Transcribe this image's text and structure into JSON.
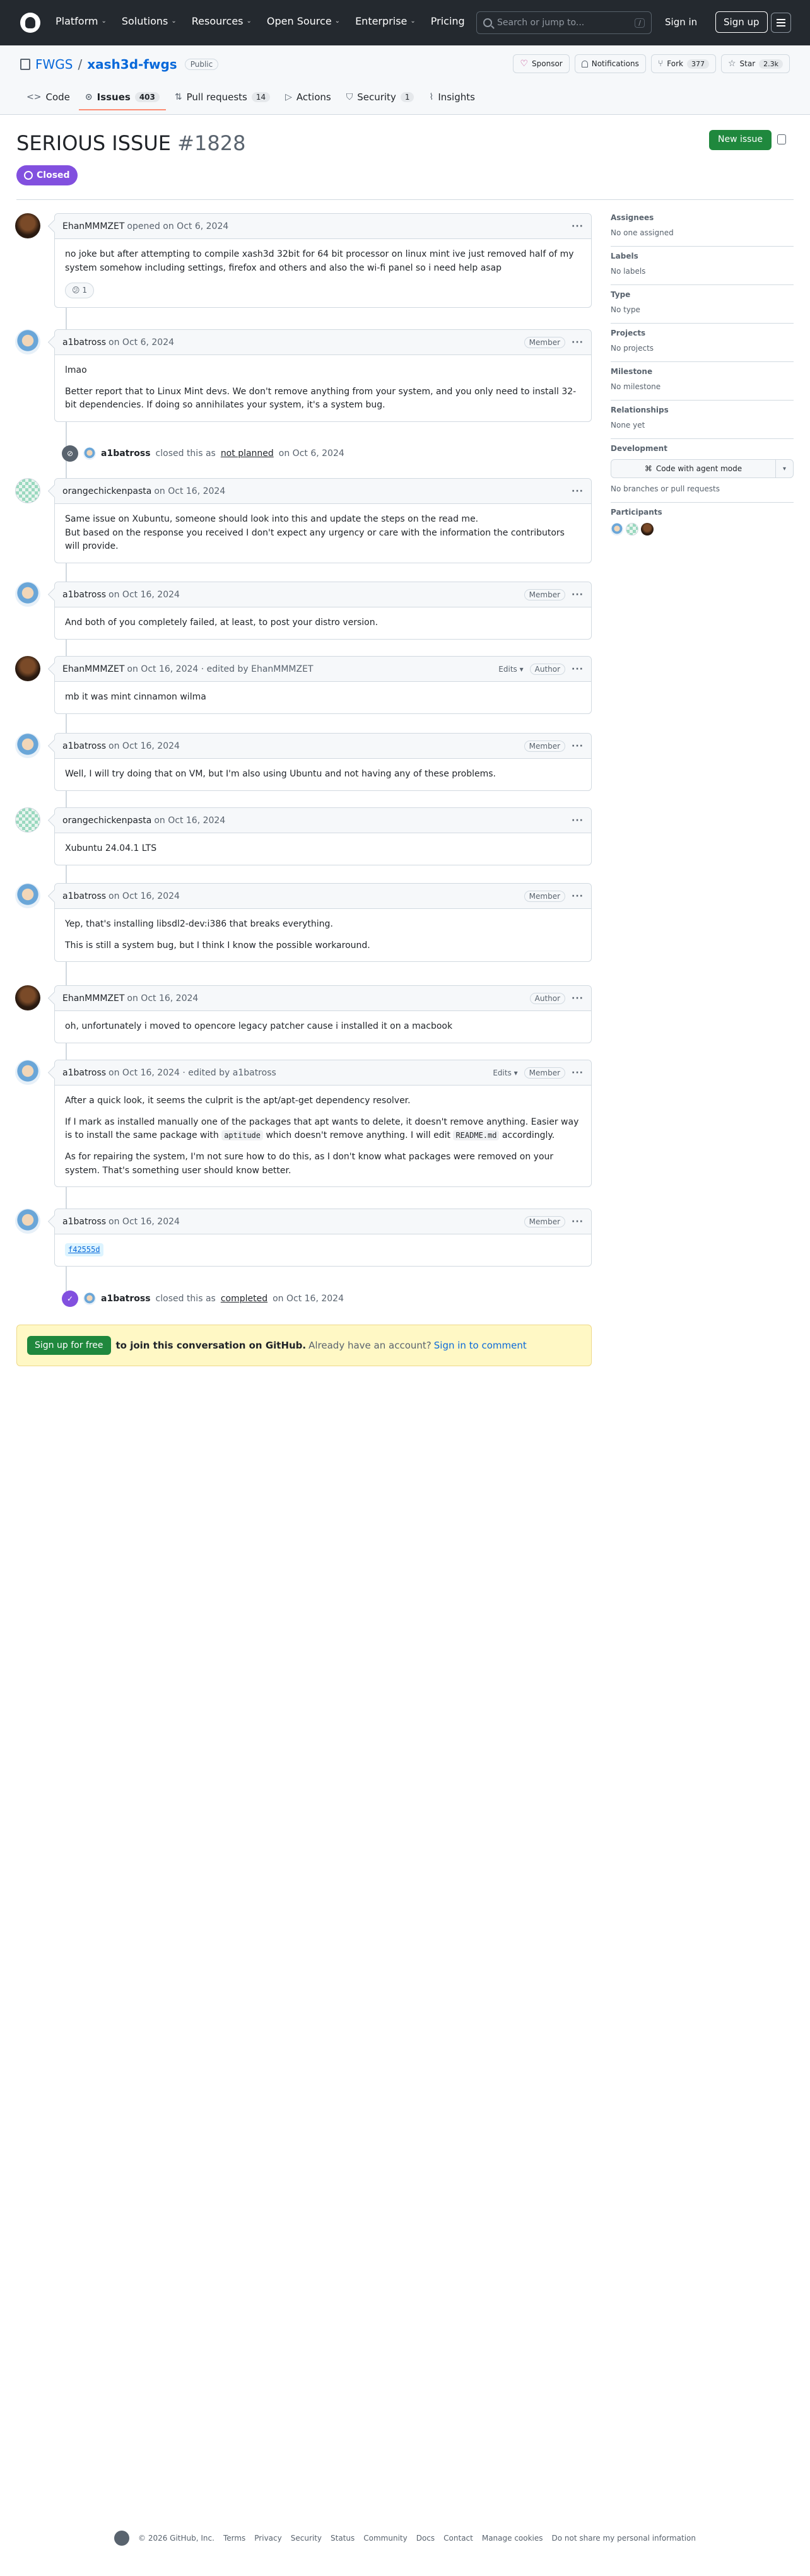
{
  "header": {
    "nav": [
      {
        "label": "Platform",
        "name": "platform"
      },
      {
        "label": "Solutions",
        "name": "solutions"
      },
      {
        "label": "Resources",
        "name": "resources"
      },
      {
        "label": "Open Source",
        "name": "open-source"
      },
      {
        "label": "Enterprise",
        "name": "enterprise"
      },
      {
        "label": "Pricing",
        "name": "pricing"
      }
    ],
    "search_placeholder": "Search or jump to...",
    "search_key": "/",
    "sign_in": "Sign in",
    "sign_up": "Sign up"
  },
  "repo": {
    "owner": "FWGS",
    "name": "xash3d-fwgs",
    "visibility": "Public",
    "sponsor": "Sponsor",
    "notifications": "Notifications",
    "fork_label": "Fork",
    "fork_count": "377",
    "star_label": "Star",
    "star_count": "2.3k",
    "tabs": [
      {
        "label": "Code",
        "count": "",
        "icon": "<>",
        "name": "code"
      },
      {
        "label": "Issues",
        "count": "403",
        "icon": "⊙",
        "name": "issues",
        "active": true
      },
      {
        "label": "Pull requests",
        "count": "14",
        "icon": "⇅",
        "name": "pull-requests"
      },
      {
        "label": "Actions",
        "count": "",
        "icon": "▷",
        "name": "actions"
      },
      {
        "label": "Security",
        "count": "1",
        "icon": "⛉",
        "name": "security"
      },
      {
        "label": "Insights",
        "count": "",
        "icon": "⌇",
        "name": "insights"
      }
    ]
  },
  "issue": {
    "title": "SERIOUS ISSUE",
    "number": "#1828",
    "state": "Closed",
    "new_issue": "New issue"
  },
  "comments": [
    {
      "author": "EhanMMMZET",
      "meta": "opened on Oct 6, 2024",
      "role": "",
      "edits": "",
      "avatar": "dark",
      "paragraphs": [
        "no joke but after attempting to compile xash3d 32bit for 64 bit processor on linux mint ive just removed half of my system somehow including settings, firefox and others and also the wi-fi panel so i need help asap"
      ],
      "reaction": "😕 1"
    },
    {
      "author": "a1batross",
      "meta": "on Oct 6, 2024",
      "role": "Member",
      "edits": "",
      "avatar": "blue",
      "paragraphs": [
        "lmao",
        "Better report that to Linux Mint devs. We don't remove anything from your system, and you only need to install 32-bit dependencies. If doing so annihilates your system, it's a system bug."
      ]
    },
    {
      "author": "orangechickenpasta",
      "meta": "on Oct 16, 2024",
      "role": "",
      "edits": "",
      "avatar": "mint",
      "paragraphs": [
        "Same issue on Xubuntu, someone should look into this and update the steps on the read me.\nBut based on the response you received I don't expect any urgency or care with the information the contributors will provide."
      ]
    },
    {
      "author": "a1batross",
      "meta": "on Oct 16, 2024",
      "role": "Member",
      "edits": "",
      "avatar": "blue",
      "paragraphs": [
        "And both of you completely failed, at least, to post your distro version."
      ]
    },
    {
      "author": "EhanMMMZET",
      "meta": "on Oct 16, 2024 · edited by EhanMMMZET",
      "role": "Author",
      "edits": "Edits ▾",
      "avatar": "dark",
      "paragraphs": [
        "mb it was mint cinnamon wilma"
      ]
    },
    {
      "author": "a1batross",
      "meta": "on Oct 16, 2024",
      "role": "Member",
      "edits": "",
      "avatar": "blue",
      "paragraphs": [
        "Well, I will try doing that on VM, but I'm also using Ubuntu and not having any of these problems."
      ]
    },
    {
      "author": "orangechickenpasta",
      "meta": "on Oct 16, 2024",
      "role": "",
      "edits": "",
      "avatar": "mint",
      "paragraphs": [
        "Xubuntu 24.04.1 LTS"
      ]
    },
    {
      "author": "a1batross",
      "meta": "on Oct 16, 2024",
      "role": "Member",
      "edits": "",
      "avatar": "blue",
      "paragraphs": [
        "Yep, that's installing libsdl2-dev:i386 that breaks everything.",
        "This is still a system bug, but I think I know the possible workaround."
      ]
    },
    {
      "author": "EhanMMMZET",
      "meta": "on Oct 16, 2024",
      "role": "Author",
      "edits": "",
      "avatar": "dark",
      "paragraphs": [
        "oh, unfortunately i moved to opencore legacy patcher cause i installed it on a macbook"
      ]
    },
    {
      "author": "a1batross",
      "meta": "on Oct 16, 2024 · edited by a1batross",
      "role": "Member",
      "edits": "Edits ▾",
      "avatar": "blue",
      "paragraphs": [
        "After a quick look, it seems the culprit is the apt/apt-get dependency resolver.",
        "If I mark as installed manually one of the packages that apt wants to delete, it doesn't remove anything. Easier way is to install the same package with {{aptitude}} which doesn't remove anything. I will edit {{README.md}} accordingly.",
        "As for repairing the system, I'm not sure how to do this, as I don't know what packages were removed on your system. That's something user should know better."
      ]
    },
    {
      "author": "a1batross",
      "meta": "on Oct 16, 2024",
      "role": "Member",
      "edits": "",
      "avatar": "blue",
      "paragraphs": [],
      "commit": "f42555d"
    }
  ],
  "events": [
    {
      "user": "a1batross",
      "pre": "closed this as",
      "link": "not planned",
      "post": "on Oct 6, 2024",
      "color": "gray"
    },
    {
      "user": "a1batross",
      "pre": "closed this as",
      "link": "completed",
      "post": "on Oct 16, 2024",
      "color": "purple"
    }
  ],
  "join": {
    "button": "Sign up for free",
    "strong": "to join this conversation on GitHub.",
    "muted": "Already have an account?",
    "link": "Sign in to comment"
  },
  "sidebar": [
    {
      "title": "Assignees",
      "value": "No one assigned",
      "name": "assignees"
    },
    {
      "title": "Labels",
      "value": "No labels",
      "name": "labels"
    },
    {
      "title": "Type",
      "value": "No type",
      "name": "type"
    },
    {
      "title": "Projects",
      "value": "No projects",
      "name": "projects"
    },
    {
      "title": "Milestone",
      "value": "No milestone",
      "name": "milestone"
    },
    {
      "title": "Relationships",
      "value": "None yet",
      "name": "relationships"
    }
  ],
  "development": {
    "title": "Development",
    "button": "Code with agent mode",
    "value": "No branches or pull requests"
  },
  "participants": {
    "title": "Participants",
    "avatars": [
      "blue",
      "mint",
      "dark"
    ]
  },
  "footer": {
    "copyright": "© 2026 GitHub, Inc.",
    "links": [
      "Terms",
      "Privacy",
      "Security",
      "Status",
      "Community",
      "Docs",
      "Contact",
      "Manage cookies",
      "Do not share my personal information"
    ]
  }
}
